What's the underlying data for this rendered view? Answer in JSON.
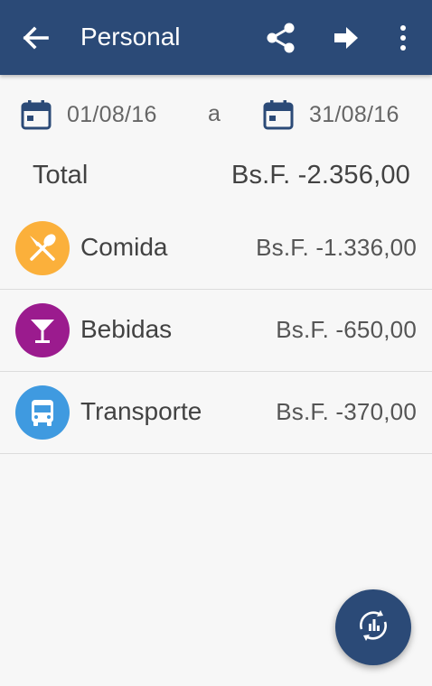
{
  "appbar": {
    "title": "Personal",
    "color": "#2b4a77",
    "icons": [
      "back-arrow-icon",
      "share-icon",
      "forward-arrow-icon",
      "more-vert-icon"
    ]
  },
  "date_range": {
    "from": "01/08/16",
    "separator": "a",
    "to": "31/08/16",
    "icon": "calendar-icon"
  },
  "total": {
    "label": "Total",
    "value": "Bs.F. -2.356,00"
  },
  "categories": [
    {
      "name": "Comida",
      "amount": "Bs.F. -1.336,00",
      "icon": "fork-spoon-icon",
      "color": "#fbb03b"
    },
    {
      "name": "Bebidas",
      "amount": "Bs.F. -650,00",
      "icon": "cocktail-glass-icon",
      "color": "#9b1b8e"
    },
    {
      "name": "Transporte",
      "amount": "Bs.F. -370,00",
      "icon": "bus-icon",
      "color": "#3f9ae0"
    }
  ],
  "fab": {
    "icon": "chart-refresh-icon",
    "color": "#2b4a77"
  }
}
